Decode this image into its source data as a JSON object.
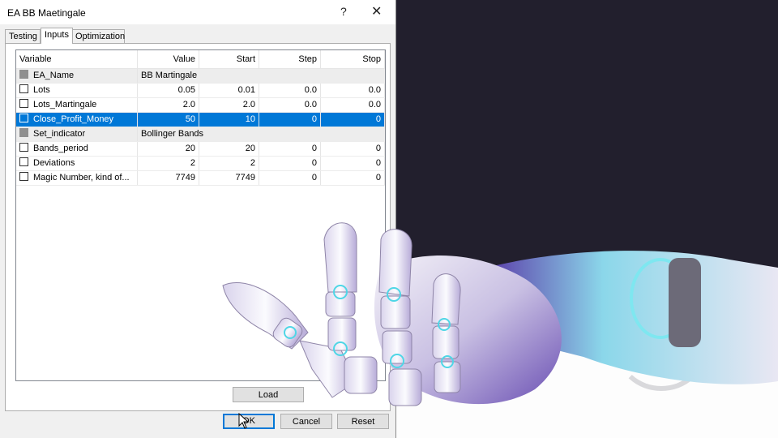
{
  "dialog": {
    "title": "EA BB Maetingale",
    "help_label": "?",
    "close_label": "✕",
    "tabs": [
      {
        "label": "Testing"
      },
      {
        "label": "Inputs"
      },
      {
        "label": "Optimization"
      }
    ],
    "active_tab": "Inputs",
    "columns": [
      "Variable",
      "Value",
      "Start",
      "Step",
      "Stop"
    ],
    "rows": [
      {
        "variable": "EA_Name",
        "value": "BB Martingale",
        "start": "",
        "step": "",
        "stop": ""
      },
      {
        "variable": "Lots",
        "value": "0.05",
        "start": "0.01",
        "step": "0.0",
        "stop": "0.0"
      },
      {
        "variable": "Lots_Martingale",
        "value": "2.0",
        "start": "2.0",
        "step": "0.0",
        "stop": "0.0"
      },
      {
        "variable": "Close_Profit_Money",
        "value": "50",
        "start": "10",
        "step": "0",
        "stop": "0"
      },
      {
        "variable": "Set_indicator",
        "value": "Bollinger Bands",
        "start": "",
        "step": "",
        "stop": ""
      },
      {
        "variable": "Bands_period",
        "value": "20",
        "start": "20",
        "step": "0",
        "stop": "0"
      },
      {
        "variable": "Deviations",
        "value": "2",
        "start": "2",
        "step": "0",
        "stop": "0"
      },
      {
        "variable": "Magic Number, kind of...",
        "value": "7749",
        "start": "7749",
        "step": "0",
        "stop": "0"
      }
    ],
    "selected_row": "Close_Profit_Money",
    "buttons": {
      "load": "Load",
      "ok": "OK",
      "cancel": "Cancel",
      "reset": "Reset"
    }
  },
  "colors": {
    "selection": "#0078d7",
    "background_dark": "#221f2d",
    "hand_accent": "#7ee7f0"
  },
  "icons": [
    "help-icon",
    "close-icon",
    "checkbox-icon",
    "mouse-cursor-icon"
  ]
}
